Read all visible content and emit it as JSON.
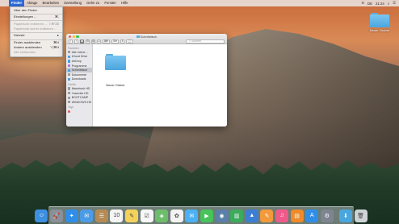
{
  "menubar": {
    "apple_glyph": "",
    "items": [
      "Finder",
      "Ablage",
      "Bearbeiten",
      "Darstellung",
      "Gehe zu",
      "Fenster",
      "Hilfe"
    ],
    "status": {
      "clock": "21:24",
      "language": "DE"
    }
  },
  "finder_menu": {
    "items": [
      {
        "label": "Über den Finder",
        "shortcut": "",
        "enabled": true
      },
      {
        "separator": true
      },
      {
        "label": "Einstellungen ...",
        "shortcut": "⌘,",
        "enabled": true
      },
      {
        "separator": true
      },
      {
        "label": "Papierkorb entleeren ...",
        "shortcut": "⇧⌘⌫",
        "enabled": false
      },
      {
        "label": "Papierkorb sicher entleeren ...",
        "shortcut": "",
        "enabled": false
      },
      {
        "separator": true
      },
      {
        "label": "Dienste",
        "shortcut": "▸",
        "enabled": true
      },
      {
        "separator": true
      },
      {
        "label": "Finder ausblenden",
        "shortcut": "⌘H",
        "enabled": true
      },
      {
        "label": "Andere ausblenden",
        "shortcut": "⌥⌘H",
        "enabled": true
      },
      {
        "label": "Alle einblenden",
        "shortcut": "",
        "enabled": false
      }
    ]
  },
  "desktop": {
    "folder_label": "Neuer Ordner"
  },
  "finder_window": {
    "title": "Schreibtisch",
    "search_placeholder": "Suchen",
    "sidebar": {
      "sections": [
        {
          "title": "Favoriten",
          "items": [
            {
              "label": "Alle meine ...",
              "icon": "all-files-icon",
              "color": "#9a9a9a"
            },
            {
              "label": "iCloud Drive",
              "icon": "cloud-icon",
              "color": "#4a9ee0"
            },
            {
              "label": "AirDrop",
              "icon": "airdrop-icon",
              "color": "#4a9ee0"
            },
            {
              "label": "Programme",
              "icon": "applications-icon",
              "color": "#b07ad8"
            },
            {
              "label": "Schreibtisch",
              "icon": "desktop-icon",
              "color": "#4a9ee0",
              "selected": true
            },
            {
              "label": "Dokumente",
              "icon": "documents-icon",
              "color": "#9a9a9a"
            },
            {
              "label": "Downloads",
              "icon": "downloads-icon",
              "color": "#4a9ee0"
            }
          ]
        },
        {
          "title": "Geräte",
          "items": [
            {
              "label": "Macintosh HD",
              "icon": "disk-icon",
              "color": "#9a9a9a"
            },
            {
              "label": "Yosemite HD",
              "icon": "disk-icon",
              "color": "#9a9a9a"
            },
            {
              "label": "BOOTCAMP",
              "icon": "disk-icon",
              "color": "#9a9a9a"
            },
            {
              "label": "WINDOWS-HD",
              "icon": "disk-icon",
              "color": "#9a9a9a"
            }
          ]
        },
        {
          "title": "Tags",
          "items": [
            {
              "label": "",
              "icon": "tag-red-icon",
              "color": "#e05a5a"
            }
          ]
        }
      ]
    },
    "content": {
      "folder_label": "Neuer Ordner"
    }
  },
  "dock": {
    "apps": [
      {
        "name": "finder-icon",
        "color": "#3d8fe0",
        "glyph": "☺"
      },
      {
        "name": "launchpad-icon",
        "color": "#8a8f99",
        "glyph": "🚀"
      },
      {
        "name": "safari-icon",
        "color": "#2f8ee8",
        "glyph": "✦"
      },
      {
        "name": "mail-icon",
        "color": "#4b9be6",
        "glyph": "✉"
      },
      {
        "name": "contacts-icon",
        "color": "#b58a55",
        "glyph": "☰"
      },
      {
        "name": "calendar-icon",
        "color": "#f4f4f4",
        "glyph": "10"
      },
      {
        "name": "notes-icon",
        "color": "#f3d15a",
        "glyph": "✎"
      },
      {
        "name": "reminders-icon",
        "color": "#f7f7f7",
        "glyph": "☑"
      },
      {
        "name": "maps-icon",
        "color": "#6dbd6a",
        "glyph": "◈"
      },
      {
        "name": "photos-icon",
        "color": "#f3f3f3",
        "glyph": "✿"
      },
      {
        "name": "messages-icon",
        "color": "#4bb0f5",
        "glyph": "✉"
      },
      {
        "name": "facetime-icon",
        "color": "#46c35a",
        "glyph": "▶"
      },
      {
        "name": "iphoto-icon",
        "color": "#5a7fa8",
        "glyph": "◉"
      },
      {
        "name": "numbers-icon",
        "color": "#3cab5c",
        "glyph": "▥"
      },
      {
        "name": "keynote-icon",
        "color": "#3c7ed6",
        "glyph": "▲"
      },
      {
        "name": "pages-icon",
        "color": "#f39a3c",
        "glyph": "✎"
      },
      {
        "name": "itunes-icon",
        "color": "#f05a8a",
        "glyph": "♫"
      },
      {
        "name": "ibooks-icon",
        "color": "#f08a2a",
        "glyph": "▤"
      },
      {
        "name": "app-store-icon",
        "color": "#2f8ee8",
        "glyph": "A"
      },
      {
        "name": "system-preferences-icon",
        "color": "#7f8590",
        "glyph": "⚙"
      }
    ],
    "trailing": [
      {
        "name": "downloads-stack-icon",
        "color": "#4aa6df",
        "glyph": "⬇"
      },
      {
        "name": "trash-icon",
        "color": "#cfd3d8",
        "glyph": "🗑"
      }
    ]
  }
}
